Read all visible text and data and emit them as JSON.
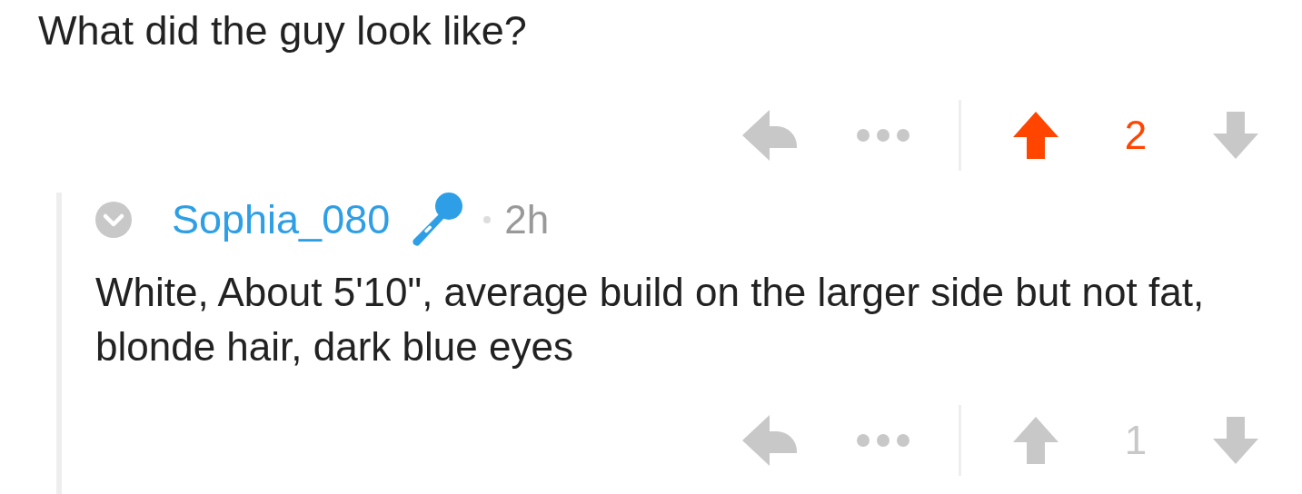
{
  "post": {
    "text": "What did the guy look like?",
    "actions": {
      "score": "2",
      "upvoted": true,
      "downvoted": false
    }
  },
  "reply": {
    "author": "Sophia_080",
    "age": "2h",
    "collapsed": false,
    "text": "White, About 5'10\", average build on the larger side but not fat, blonde hair, dark blue eyes",
    "actions": {
      "score": "1",
      "upvoted": false,
      "downvoted": false
    }
  }
}
